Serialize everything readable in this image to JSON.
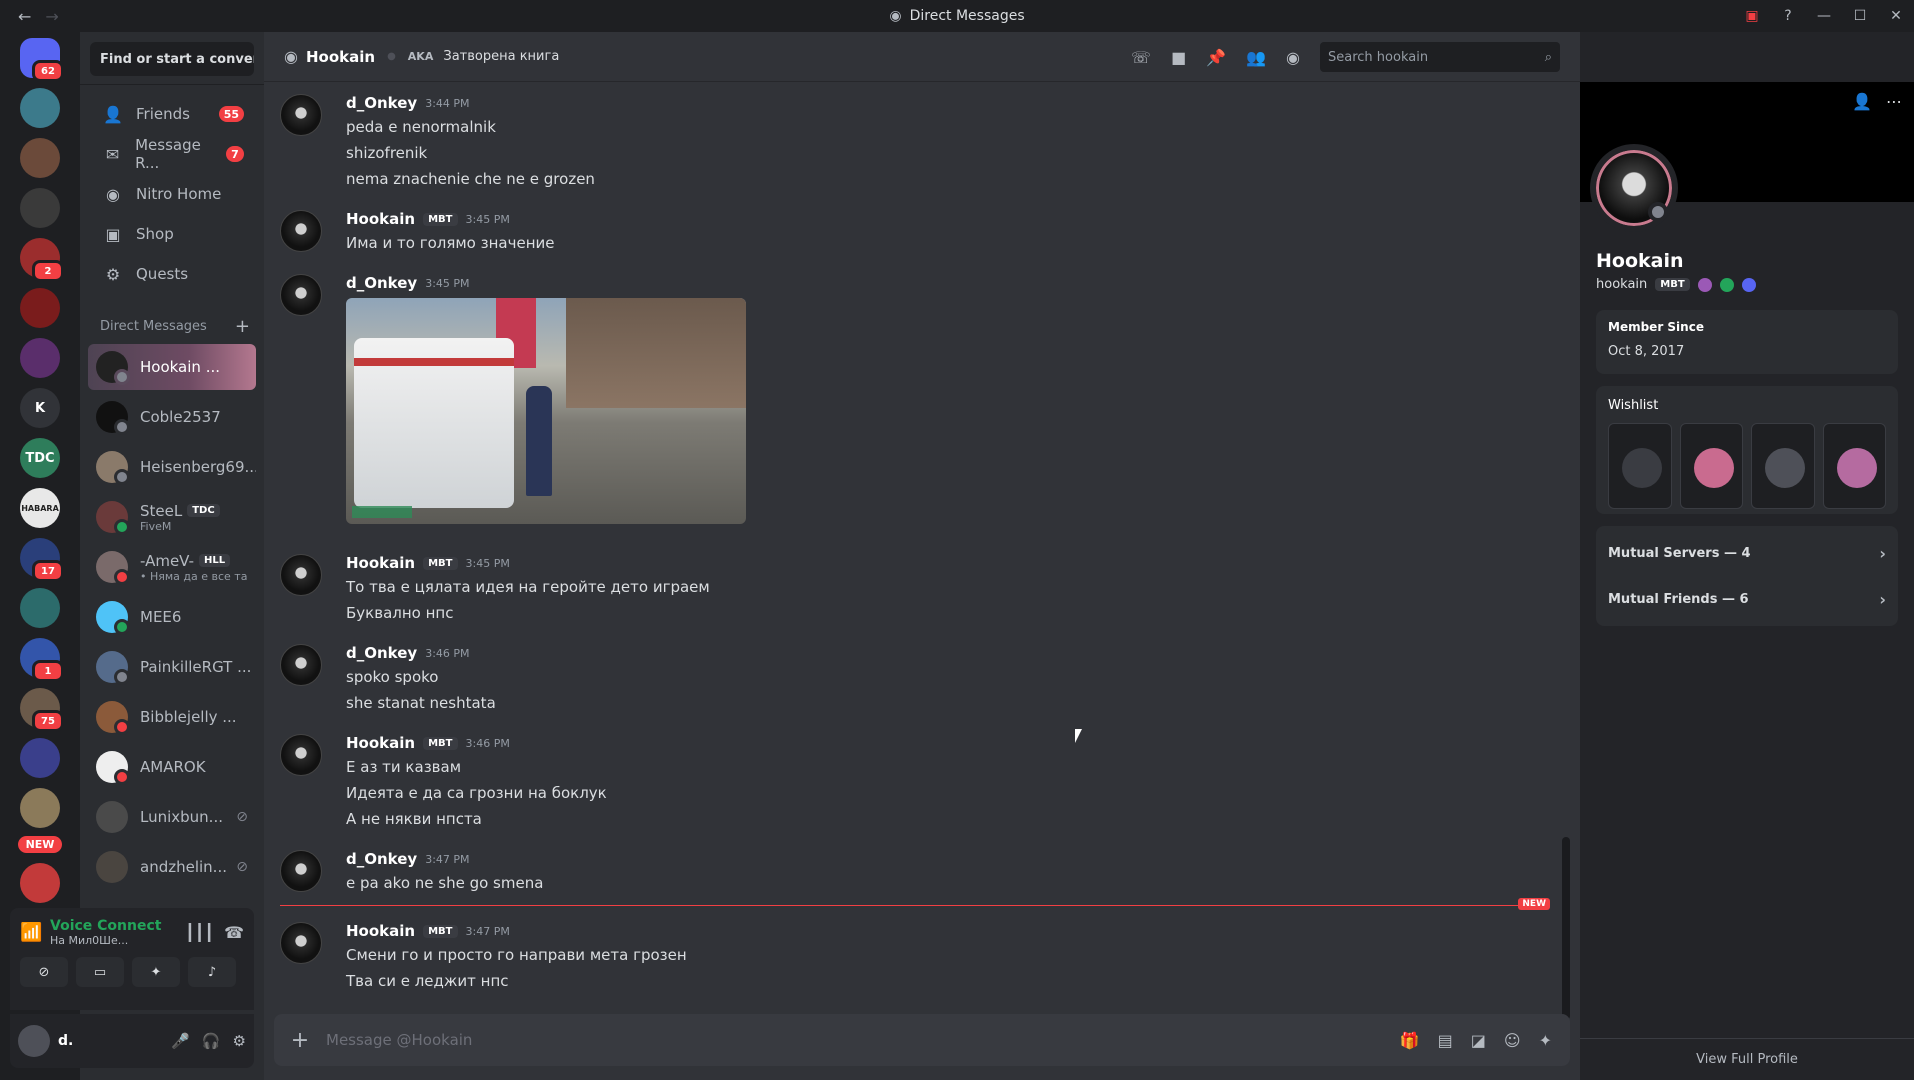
{
  "window": {
    "title": "Direct Messages"
  },
  "guilds": [
    {
      "label": "",
      "badge": "62",
      "color": "#5865f2"
    },
    {
      "label": "",
      "badge": "",
      "color": "#3c7a8b"
    },
    {
      "label": "",
      "badge": "",
      "color": "#6b4a3a"
    },
    {
      "label": "",
      "badge": "",
      "color": "#3a3a3a"
    },
    {
      "label": "",
      "badge": "2",
      "color": "#9b2d2d"
    },
    {
      "label": "",
      "badge": "",
      "color": "#7a1c1c"
    },
    {
      "label": "",
      "badge": "",
      "color": "#5a2e6b"
    },
    {
      "label": "K",
      "badge": "",
      "color": "#313338"
    },
    {
      "label": "TDC",
      "badge": "",
      "color": "#2e7d5b"
    },
    {
      "label": "HABARA",
      "badge": "",
      "color": "#e8e8e8"
    },
    {
      "label": "",
      "badge": "17",
      "color": "#2a3f7a"
    },
    {
      "label": "",
      "badge": "",
      "color": "#2c6b6b"
    },
    {
      "label": "",
      "badge": "1",
      "color": "#3355aa"
    },
    {
      "label": "",
      "badge": "75",
      "color": "#6b5a4a"
    },
    {
      "label": "",
      "badge": "",
      "color": "#3a3f8b"
    },
    {
      "label": "",
      "badge": "",
      "color": "#8b7a5a"
    },
    {
      "label": "",
      "badge": "",
      "color": "#c23a3a"
    }
  ],
  "new_pill": "NEW",
  "sidebar": {
    "find_placeholder": "Find or start a conver...",
    "nav": [
      {
        "label": "Friends",
        "count": "55",
        "icon": "friends-icon",
        "glyph": "👤"
      },
      {
        "label": "Message R...",
        "count": "7",
        "icon": "envelope-icon",
        "glyph": "✉"
      },
      {
        "label": "Nitro Home",
        "count": "",
        "icon": "nitro-icon",
        "glyph": "◉"
      },
      {
        "label": "Shop",
        "count": "",
        "icon": "shop-icon",
        "glyph": "▣"
      },
      {
        "label": "Quests",
        "count": "",
        "icon": "quests-icon",
        "glyph": "⚙"
      }
    ],
    "dm_header": "Direct Messages",
    "dms": [
      {
        "name": "Hookain ...",
        "tag": "",
        "sub": "",
        "status": "off",
        "active": true,
        "blocked": false,
        "color": "#222"
      },
      {
        "name": "Coble2537",
        "tag": "",
        "sub": "",
        "status": "off",
        "active": false,
        "blocked": false,
        "color": "#111"
      },
      {
        "name": "Heisenberg69...",
        "tag": "",
        "sub": "",
        "status": "off",
        "active": false,
        "blocked": false,
        "color": "#8a7a6a"
      },
      {
        "name": "SteeL",
        "tag": "TDC",
        "sub": "FiveM",
        "status": "on",
        "active": false,
        "blocked": false,
        "color": "#6a3a3a"
      },
      {
        "name": "-AmeV-",
        "tag": "HLL",
        "sub": "• Няма да е все та",
        "status": "dnd",
        "active": false,
        "blocked": false,
        "color": "#7a6a6a"
      },
      {
        "name": "MEE6",
        "tag": "",
        "sub": "",
        "status": "on",
        "active": false,
        "blocked": false,
        "color": "#4fc3f7"
      },
      {
        "name": "PainkilleRGT ...",
        "tag": "",
        "sub": "",
        "status": "off",
        "active": false,
        "blocked": false,
        "color": "#556b8b"
      },
      {
        "name": "Bibblejelly ...",
        "tag": "",
        "sub": "",
        "status": "dnd",
        "active": false,
        "blocked": false,
        "color": "#8b5a3a"
      },
      {
        "name": "AMAROK",
        "tag": "",
        "sub": "",
        "status": "dnd",
        "active": false,
        "blocked": false,
        "color": "#eee"
      },
      {
        "name": "Lunixbun...",
        "tag": "",
        "sub": "",
        "status": "",
        "active": false,
        "blocked": true,
        "color": "#4a4a4a"
      },
      {
        "name": "andzhelin...",
        "tag": "",
        "sub": "",
        "status": "",
        "active": false,
        "blocked": true,
        "color": "#4a4540"
      }
    ]
  },
  "voice": {
    "title": "Voice Connect",
    "channel": "На Мил0Ше..."
  },
  "user": {
    "name": "d."
  },
  "chat": {
    "recipient": "Hookain",
    "aka": "AKA",
    "alias": "Затворена книга",
    "search_placeholder": "Search hookain",
    "composer_placeholder": "Message @Hookain",
    "new_label": "NEW",
    "messages": [
      {
        "author": "d_Onkey",
        "tag": "",
        "time": "3:44 PM",
        "lines": [
          "peda e nenormalnik",
          "shizofrenik",
          "nema znachenie che ne e grozen"
        ],
        "image": false,
        "gap": 0
      },
      {
        "author": "Hookain",
        "tag": "MBT",
        "time": "3:45 PM",
        "lines": [
          "Има и то голямо значение"
        ],
        "image": false,
        "gap": 16
      },
      {
        "author": "d_Onkey",
        "tag": "",
        "time": "3:45 PM",
        "lines": [],
        "image": true,
        "gap": 16
      },
      {
        "author": "Hookain",
        "tag": "MBT",
        "time": "3:45 PM",
        "lines": [
          "То тва е цялата идея на геройте дето играем",
          "Буквално нпс"
        ],
        "image": false,
        "gap": 28
      },
      {
        "author": "d_Onkey",
        "tag": "",
        "time": "3:46 PM",
        "lines": [
          "spoko spoko",
          "she stanat neshtata"
        ],
        "image": false,
        "gap": 16
      },
      {
        "author": "Hookain",
        "tag": "MBT",
        "time": "3:46 PM",
        "lines": [
          "Е аз ти казвам",
          "Идеята е да са грозни на боклук",
          "А не някви нпста"
        ],
        "image": false,
        "gap": 16
      },
      {
        "author": "d_Onkey",
        "tag": "",
        "time": "3:47 PM",
        "lines": [
          "е ра ako ne she go smena"
        ],
        "image": false,
        "gap": 16
      },
      {
        "author": "Hookain",
        "tag": "MBT",
        "time": "3:47 PM",
        "lines": [
          "Смени го и просто го направи мета грозен",
          "Тва си е леджит нпс"
        ],
        "image": false,
        "gap": 24
      }
    ]
  },
  "profile": {
    "display_name": "Hookain",
    "username": "hookain",
    "tag": "MBT",
    "member_since_label": "Member Since",
    "member_since": "Oct 8, 2017",
    "wishlist_label": "Wishlist",
    "mutual_servers": "Mutual Servers — 4",
    "mutual_friends": "Mutual Friends — 6",
    "view_full": "View Full Profile"
  }
}
